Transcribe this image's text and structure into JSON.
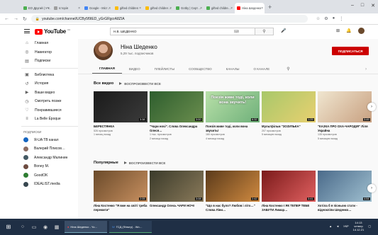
{
  "browser": {
    "tabs": [
      {
        "label": "ЕО Другий | Уч…",
        "color": "#4caf50"
      },
      {
        "label": "Історія",
        "color": "#9e9e9e"
      },
      {
        "label": "Google - Міст…",
        "color": "#4285f4"
      },
      {
        "label": "gifted children",
        "color": "#fbbc05"
      },
      {
        "label": "gifted childrer…",
        "color": "#fbbc05"
      },
      {
        "label": "Gotby | Серт…",
        "color": "#4caf50"
      },
      {
        "label": "gifted childre…",
        "color": "#4caf50"
      },
      {
        "label": "Ніна Шеденко",
        "color": "#ff0000"
      }
    ],
    "new_tab": "+",
    "url": "youtube.com/channel/UCBy5f9IED_yGrGRgcrA8ZIA"
  },
  "masthead": {
    "logo_text": "YouTube",
    "logo_country": "UA",
    "search_value": "Н.В. ШЕДЕНКО",
    "search_icon": "search-icon"
  },
  "sidebar": {
    "main": [
      {
        "icon": "home-icon",
        "glyph": "⌂",
        "label": "Главная"
      },
      {
        "icon": "compass-icon",
        "glyph": "◎",
        "label": "Навигатор"
      },
      {
        "icon": "subscriptions-icon",
        "glyph": "▤",
        "label": "Подписки"
      }
    ],
    "library": [
      {
        "icon": "library-icon",
        "glyph": "▣",
        "label": "Библиотека"
      },
      {
        "icon": "history-icon",
        "glyph": "↺",
        "label": "История"
      },
      {
        "icon": "your-videos-icon",
        "glyph": "▶",
        "label": "Ваши видео"
      },
      {
        "icon": "watch-later-icon",
        "glyph": "◷",
        "label": "Смотреть позже"
      },
      {
        "icon": "liked-icon",
        "glyph": "♡",
        "label": "Понравившиеся"
      },
      {
        "icon": "playlist-icon",
        "glyph": "≡",
        "label": "La Belle Époque"
      }
    ],
    "subs_heading": "ПОДПИСКИ",
    "subs": [
      {
        "label": "Я-UA TB канал",
        "color": "#1565c0"
      },
      {
        "label": "Валерий Плисов…",
        "color": "#8d6e63"
      },
      {
        "label": "Александр Малинин",
        "color": "#455a64"
      },
      {
        "label": "Boney M.",
        "color": "#6d4c41"
      },
      {
        "label": "GoodOK",
        "color": "#2e7d32"
      },
      {
        "label": "IDEALIST.media",
        "color": "#37474f"
      }
    ]
  },
  "channel": {
    "name": "Ніна Шеденко",
    "subscribers": "5,29 тыс. подписчиков",
    "subscribe_label": "ПОДПИСАТЬСЯ",
    "tabs": [
      "ГЛАВНАЯ",
      "ВИДЕО",
      "ПЛЕЙЛИСТЫ",
      "СООБЩЕСТВО",
      "КАНАЛЫ",
      "О КАНАЛЕ"
    ],
    "sections": [
      {
        "title": "Все видео",
        "play_all": "ВОСПРОИЗВЕСТИ ВСЕ",
        "videos": [
          {
            "title": "БЕРЕСТЯНКА",
            "views": "526 просмотров",
            "age": "1 месяц назад",
            "duration": "3:38",
            "colors": [
              "#1a1a1a",
              "#3b3b3b"
            ]
          },
          {
            "title": "\"Чари ночі\". Слова Олександра Олеся…",
            "views": "1 тыс. просмотров",
            "age": "2 месяца назад",
            "duration": "3:00",
            "colors": [
              "#2e5e2e",
              "#6b8e4e"
            ]
          },
          {
            "title": "Поезія живе тоді, коли вона звучить!",
            "views": "160 просмотров",
            "age": "4 месяца назад",
            "duration": "6:32",
            "colors": [
              "#b8e0a8",
              "#6fb07a"
            ]
          },
          {
            "title": "Мультфільм \"ЗОЗУЛЬКА\"",
            "views": "207 просмотров",
            "age": "5 месяцев назад",
            "duration": "1:29",
            "colors": [
              "#a8c86a",
              "#e8d070"
            ]
          },
          {
            "title": "\"КАЗКА ПРО ОХА-ЧАРОДІЯ\" Ліля Украйна",
            "views": "135 просмотров",
            "age": "5 месяцев назад",
            "duration": "3:49",
            "colors": [
              "#f0e6d0",
              "#c8a080"
            ]
          }
        ],
        "headline": "Поезія живе тоді, коли вона звучить!"
      },
      {
        "title": "Популярные",
        "play_all": "ВОСПРОИЗВЕСТИ ВСЕ",
        "videos": [
          {
            "title": "Ліна Костенко \"Я вже на світі треба пережити\"",
            "views": "",
            "age": "",
            "duration": "2:05",
            "colors": [
              "#6a4a2a",
              "#c89060"
            ]
          },
          {
            "title": "Олександр Олесь ЧАРИ НОЧІ",
            "views": "",
            "age": "",
            "duration": "3:08",
            "colors": [
              "#3a3a2a",
              "#8a7a5a"
            ]
          },
          {
            "title": "\"Що в нас було? Любов і літо…\" Слова Ліни…",
            "views": "",
            "age": "",
            "duration": "2:42",
            "colors": [
              "#5a3a1a",
              "#d08a40"
            ]
          },
          {
            "title": "Ліна Костенко І ЯК ТЕПЕР ТЕБЕ ЗАБУТИ Лимар…",
            "views": "",
            "age": "",
            "duration": "3:41",
            "colors": [
              "#7a1a1a",
              "#e06060"
            ]
          },
          {
            "title": "Хотіла б я пісньою стати - відеокліпи Шеденко…",
            "views": "",
            "age": "",
            "duration": "4:54",
            "colors": [
              "#4a6a8a",
              "#a0c0d0"
            ]
          }
        ]
      }
    ]
  },
  "taskbar": {
    "apps": [
      "Ніна Шеденко - Yo…",
      "ГСД (Фільтр) - Wo…"
    ],
    "time": "14:13",
    "day": "четвер",
    "date": "14.12.21",
    "lang": "УКР"
  }
}
